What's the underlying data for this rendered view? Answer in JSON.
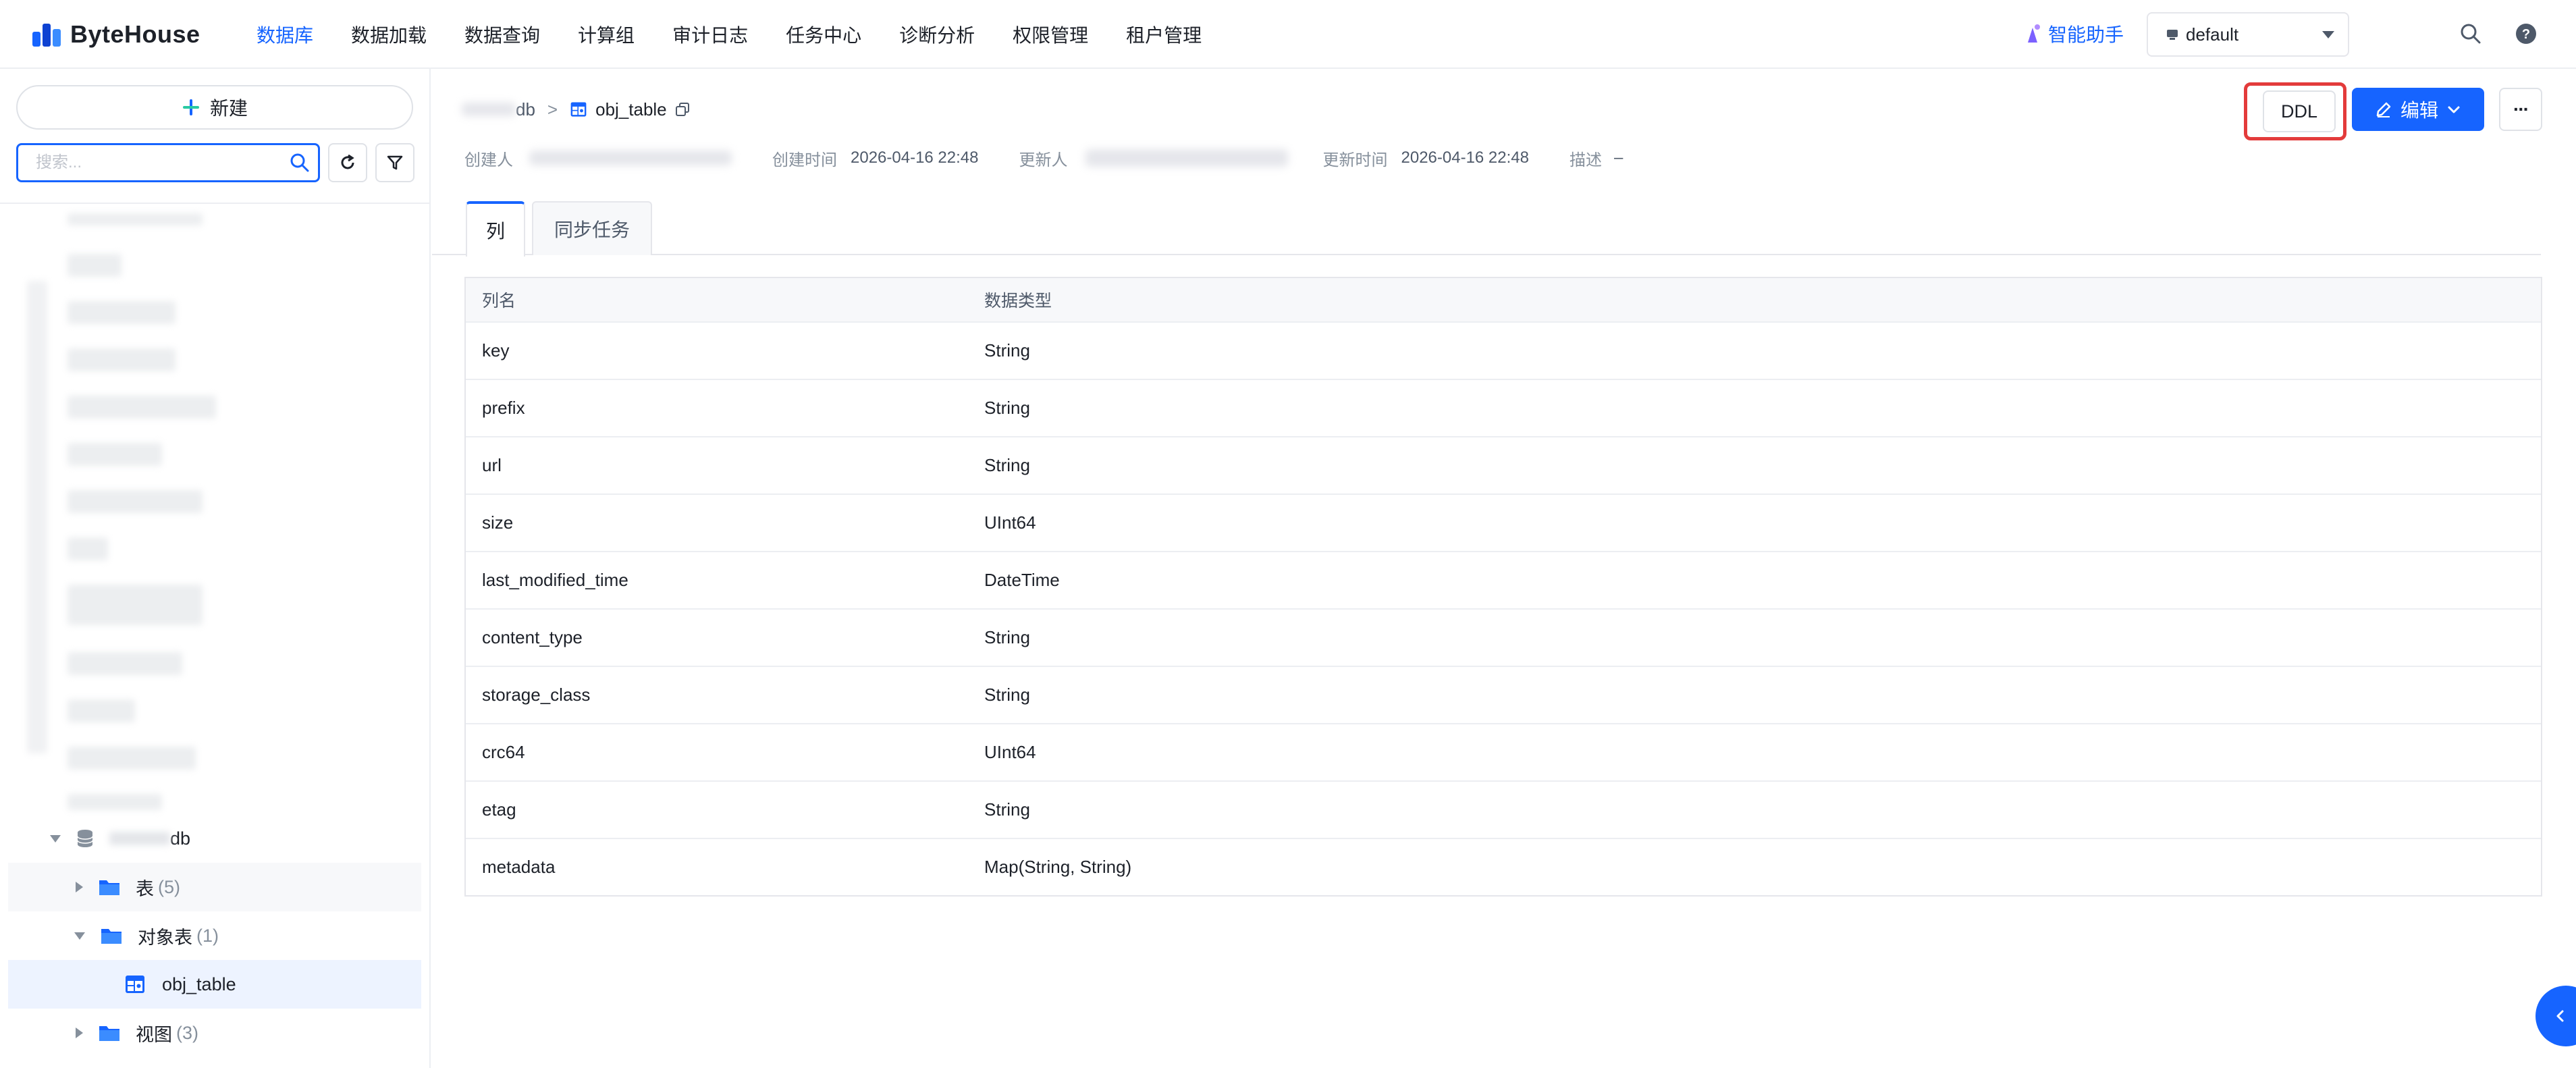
{
  "brand": {
    "name": "ByteHouse"
  },
  "nav": {
    "items": [
      {
        "label": "数据库",
        "active": true
      },
      {
        "label": "数据加载",
        "active": false
      },
      {
        "label": "数据查询",
        "active": false
      },
      {
        "label": "计算组",
        "active": false
      },
      {
        "label": "审计日志",
        "active": false
      },
      {
        "label": "任务中心",
        "active": false
      },
      {
        "label": "诊断分析",
        "active": false
      },
      {
        "label": "权限管理",
        "active": false
      },
      {
        "label": "租户管理",
        "active": false
      }
    ]
  },
  "header": {
    "assistant_label": "智能助手",
    "workspace_value": "default"
  },
  "sidebar": {
    "new_label": "新建",
    "search_placeholder": "搜索...",
    "db_suffix": "db",
    "folders": {
      "tables": {
        "label": "表",
        "count": "(5)"
      },
      "object_tables": {
        "label": "对象表",
        "count": "(1)"
      },
      "views": {
        "label": "视图",
        "count": "(3)"
      }
    },
    "selected_item": "obj_table"
  },
  "main": {
    "breadcrumb": {
      "db_suffix": "db",
      "table": "obj_table"
    },
    "meta": {
      "creator_label": "创建人",
      "created_label": "创建时间",
      "created_value": "2026-04-16 22:48",
      "updater_label": "更新人",
      "updated_label": "更新时间",
      "updated_value": "2026-04-16 22:48",
      "desc_label": "描述",
      "desc_value": "–"
    },
    "buttons": {
      "ddl": "DDL",
      "edit": "编辑",
      "more": "···"
    },
    "tabs": [
      {
        "label": "列",
        "active": true
      },
      {
        "label": "同步任务",
        "active": false
      }
    ],
    "table": {
      "headers": [
        "列名",
        "数据类型"
      ],
      "rows": [
        {
          "name": "key",
          "type": "String"
        },
        {
          "name": "prefix",
          "type": "String"
        },
        {
          "name": "url",
          "type": "String"
        },
        {
          "name": "size",
          "type": "UInt64"
        },
        {
          "name": "last_modified_time",
          "type": "DateTime"
        },
        {
          "name": "content_type",
          "type": "String"
        },
        {
          "name": "storage_class",
          "type": "String"
        },
        {
          "name": "crc64",
          "type": "UInt64"
        },
        {
          "name": "etag",
          "type": "String"
        },
        {
          "name": "metadata",
          "type": "Map(String, String)"
        }
      ]
    }
  },
  "colors": {
    "accent": "#1664ff",
    "highlight": "#e33b3b",
    "assistant": "#7b61ff"
  },
  "icons": [
    "plus-icon",
    "search-icon",
    "refresh-icon",
    "filter-icon",
    "database-icon",
    "folder-icon",
    "object-table-icon",
    "copy-icon",
    "edit-icon",
    "chevron-down-icon",
    "help-icon",
    "sparkle-icon",
    "collapse-icon"
  ]
}
